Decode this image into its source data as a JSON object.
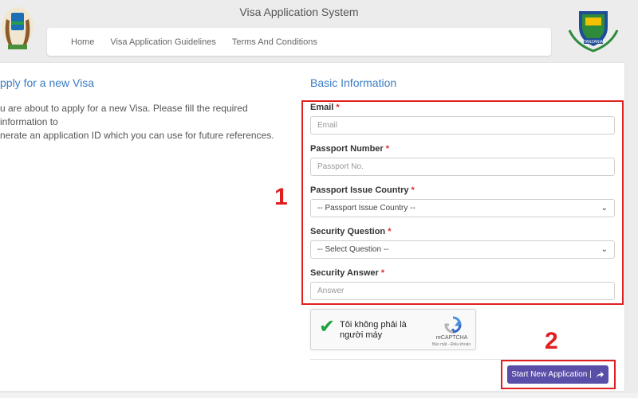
{
  "header": {
    "title": "Visa Application System",
    "right_logo_text": "TANZANIA"
  },
  "nav": {
    "items": [
      "Home",
      "Visa Application Guidelines",
      "Terms And Conditions"
    ]
  },
  "left": {
    "title": "pply for a new Visa",
    "line1": "u are about to apply for a new Visa. Please fill the required information to",
    "line2": "nerate an application ID which you can use for future references."
  },
  "form": {
    "title": "Basic Information",
    "required_marker": "*",
    "email": {
      "label": "Email",
      "placeholder": "Email"
    },
    "passport": {
      "label": "Passport Number",
      "placeholder": "Passport No."
    },
    "country": {
      "label": "Passport Issue Country",
      "selected": "-- Passport Issue Country --"
    },
    "question": {
      "label": "Security Question",
      "selected": "-- Select Question --"
    },
    "answer": {
      "label": "Security Answer",
      "placeholder": "Answer"
    }
  },
  "annotations": {
    "one": "1",
    "two": "2"
  },
  "captcha": {
    "text": "Tôi không phải là người máy",
    "brand": "reCAPTCHA",
    "links": "Bảo mật - Điều khoản"
  },
  "submit": {
    "label": "Start New Application |"
  },
  "colors": {
    "accent": "#3a7cc2",
    "highlight": "#e02020",
    "button": "#5a4fa8",
    "check": "#1ea33c"
  },
  "icons": {
    "check": "check-icon",
    "share": "share-icon",
    "recaptcha": "recaptcha-logo-icon"
  }
}
